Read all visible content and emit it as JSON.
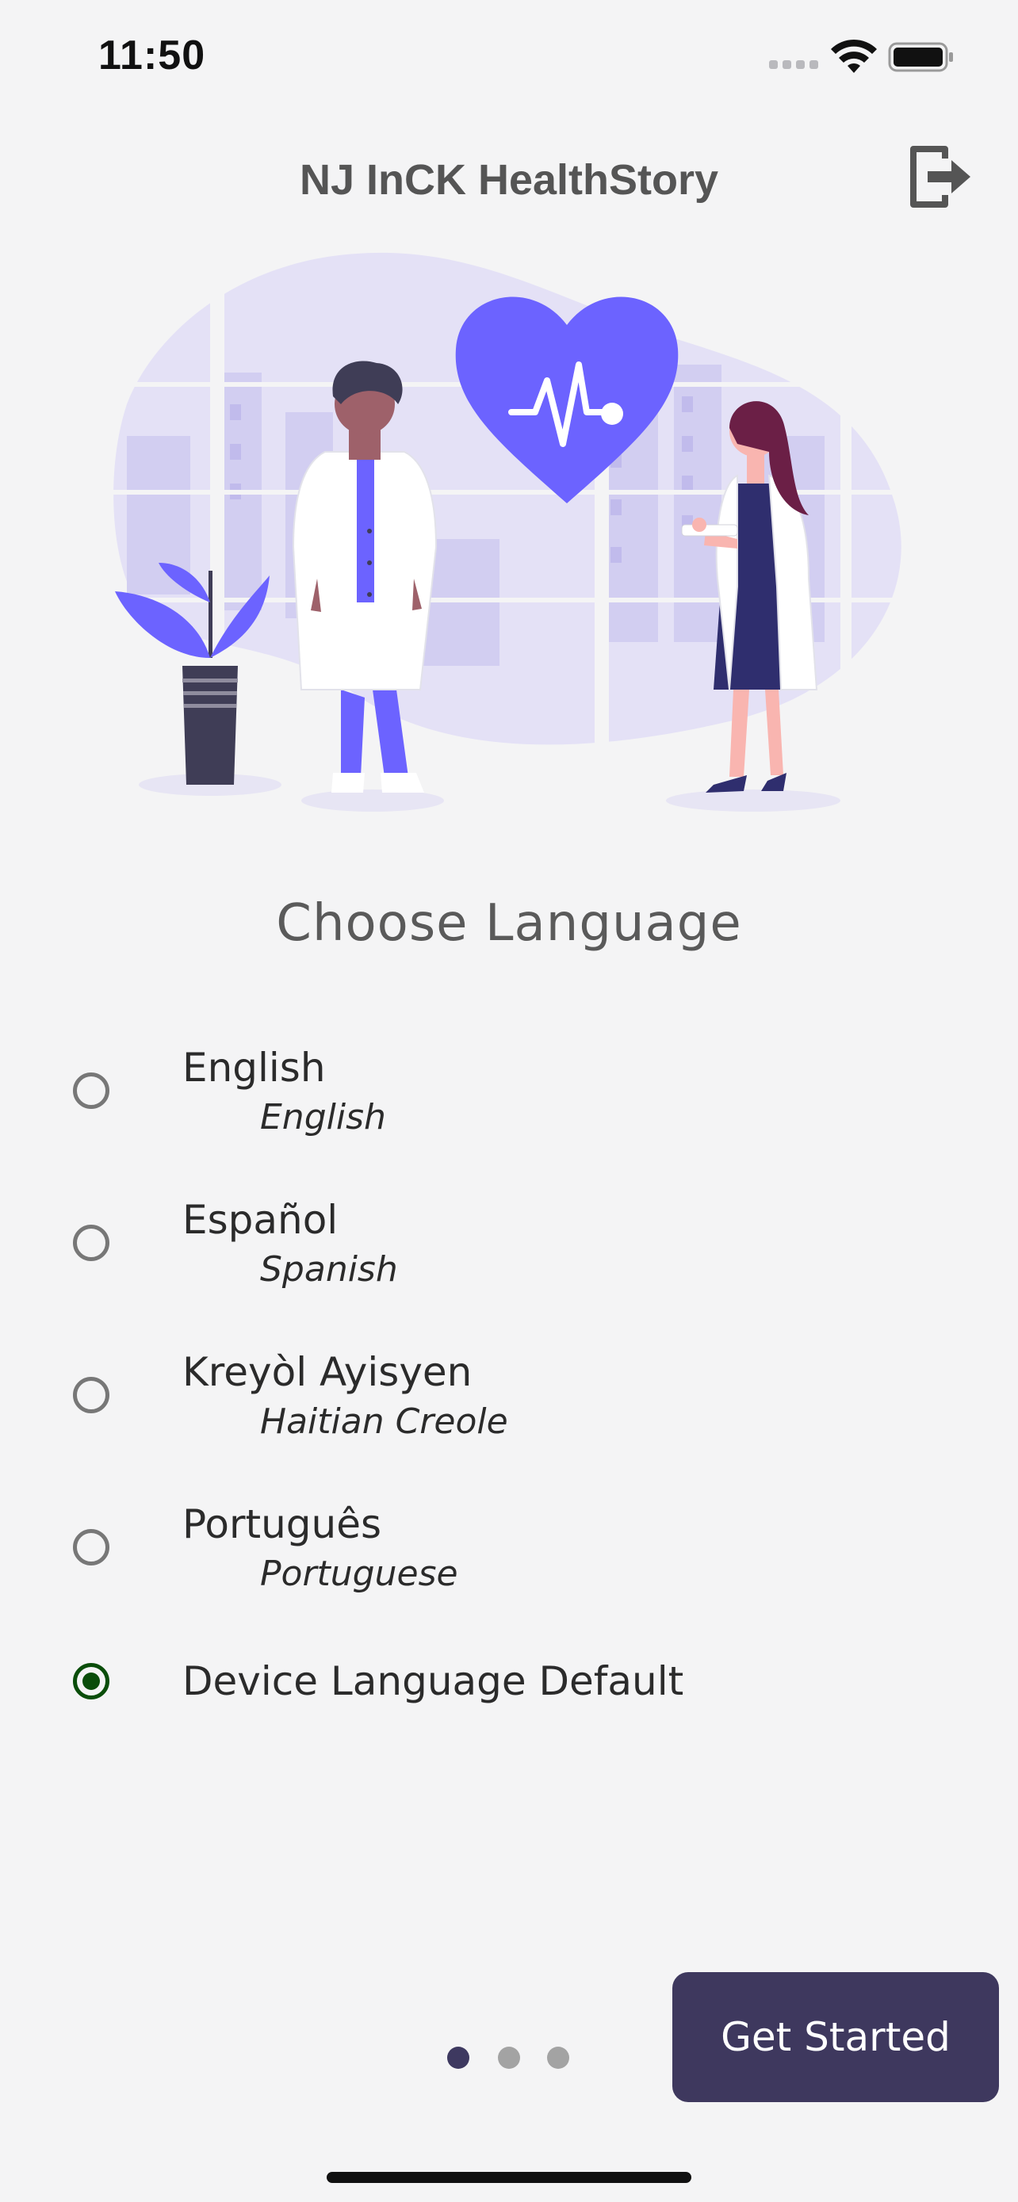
{
  "status_bar": {
    "time": "11:50",
    "icons": [
      "cellular-signal-icon",
      "wifi-icon",
      "battery-icon"
    ]
  },
  "header": {
    "title": "NJ InCK HealthStory",
    "logout_icon": "logout-icon"
  },
  "illustration": {
    "description_icon": "doctors-heart-illustration"
  },
  "main": {
    "heading": "Choose Language",
    "languages": [
      {
        "name": "English",
        "subtitle": "English",
        "selected": false
      },
      {
        "name": "Español",
        "subtitle": "Spanish",
        "selected": false
      },
      {
        "name": "Kreyòl Ayisyen",
        "subtitle": "Haitian Creole",
        "selected": false
      },
      {
        "name": "Português",
        "subtitle": "Portuguese",
        "selected": false
      },
      {
        "name": "Device Language Default",
        "subtitle": "",
        "selected": true
      }
    ]
  },
  "footer": {
    "pager": {
      "total": 3,
      "active": 1
    },
    "get_started_label": "Get Started"
  },
  "colors": {
    "background": "#f4f4f5",
    "accent": "#6c63ff",
    "button": "#3e385e",
    "radio_selected": "#0a4d0a"
  }
}
